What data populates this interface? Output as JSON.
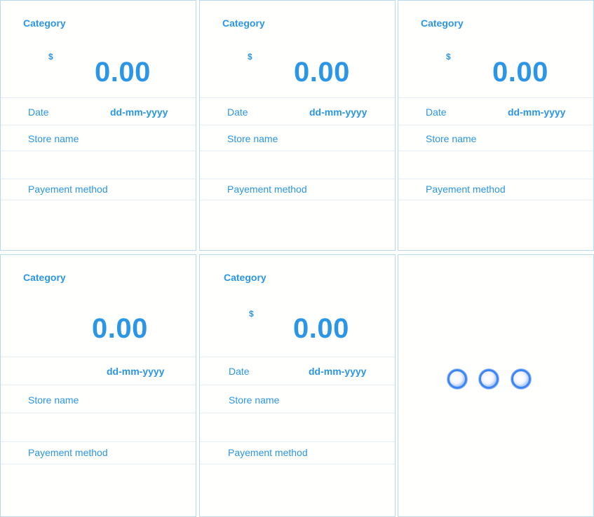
{
  "cards": [
    {
      "category": "Category",
      "currency": "$",
      "amount": "0.00",
      "date_label": "Date",
      "date_value": "dd-mm-yyyy",
      "store_label": "Store name",
      "payment_label": "Payement method"
    },
    {
      "category": "Category",
      "currency": "$",
      "amount": "0.00",
      "date_label": "Date",
      "date_value": "dd-mm-yyyy",
      "store_label": "Store name",
      "payment_label": "Payement method"
    },
    {
      "category": "Category",
      "currency": "$",
      "amount": "0.00",
      "date_label": "Date",
      "date_value": "dd-mm-yyyy",
      "store_label": "Store name",
      "payment_label": "Payement method"
    },
    {
      "category": "Category",
      "amount": "0.00",
      "date_value": "dd-mm-yyyy",
      "store_label": "Store name",
      "payment_label": "Payement method"
    },
    {
      "category": "Category",
      "currency": "$",
      "amount": "0.00",
      "date_label": "Date",
      "date_value": "dd-mm-yyyy",
      "store_label": "Store name",
      "payment_label": "Payement method"
    }
  ],
  "loading": {
    "dot_count": 3,
    "accent_color": "#3d86f2"
  },
  "colors": {
    "text": "#2b96e6",
    "border": "#b9d9ef",
    "divider": "#e6eef4"
  }
}
